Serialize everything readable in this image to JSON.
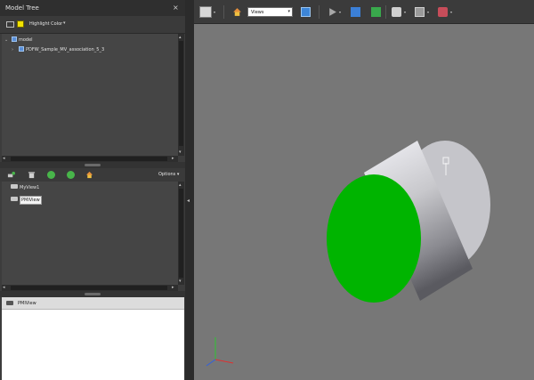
{
  "model_tree": {
    "title": "Model Tree",
    "close_label": "×",
    "highlight_color_label": "Highlight Color",
    "highlight_color_value": "#f2e200",
    "items": [
      {
        "label": "model",
        "expanded": true
      },
      {
        "label": "PDFW_Sample_MV_association_5_3",
        "expanded": false
      }
    ]
  },
  "views_panel": {
    "options_label": "Options",
    "views": [
      {
        "label": "MyView1"
      },
      {
        "label": "PMIView"
      }
    ]
  },
  "pmi_panel": {
    "header_label": "PMIView"
  },
  "toolbar": {
    "views_select_value": "Views"
  },
  "viewport": {
    "background": "#777777",
    "cylinder_face_color": "#00b400"
  }
}
